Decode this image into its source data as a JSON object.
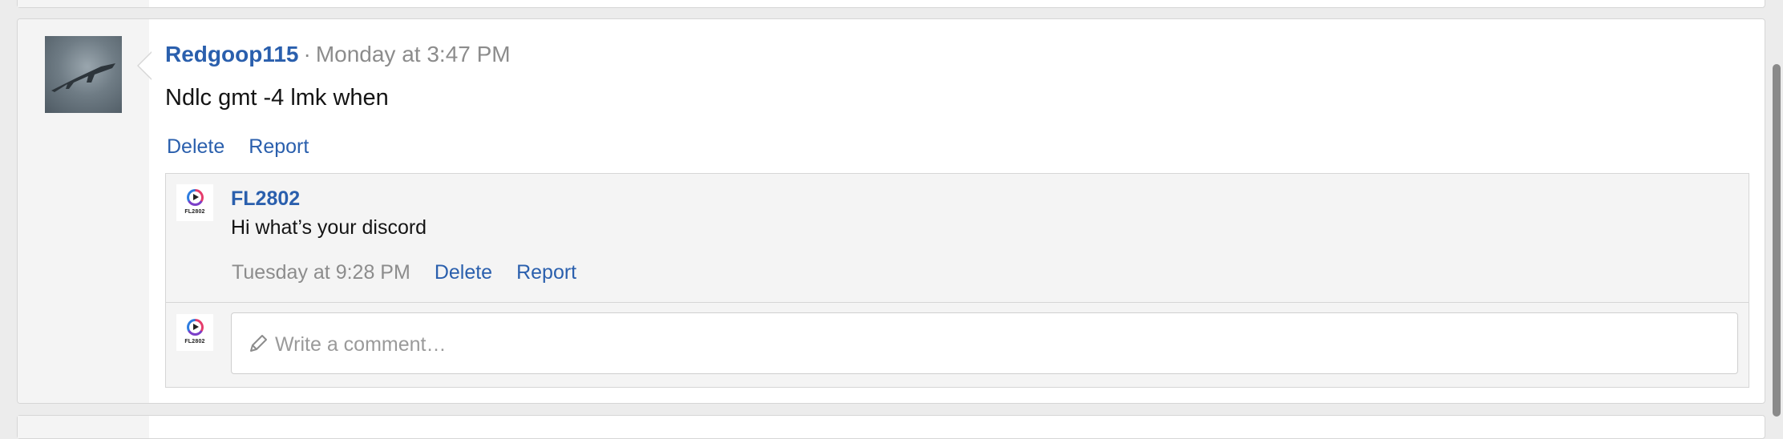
{
  "post": {
    "username": "Redgoop115",
    "separator": "·",
    "timestamp": "Monday at 3:47 PM",
    "body": "Ndlc gmt -4 lmk when",
    "actions": {
      "delete": "Delete",
      "report": "Report"
    },
    "avatar_icon": "jet-photo-avatar"
  },
  "comments": [
    {
      "username": "FL2802",
      "body": "Hi what’s your discord",
      "timestamp": "Tuesday at 9:28 PM",
      "actions": {
        "delete": "Delete",
        "report": "Report"
      },
      "avatar_logo_text": "FL2802"
    }
  ],
  "composer": {
    "placeholder": "Write a comment…",
    "avatar_logo_text": "FL2802",
    "icon": "pencil-icon"
  },
  "colors": {
    "link": "#2a5fad",
    "muted": "#8c8c8c",
    "side_panel": "#f4f4f4"
  }
}
